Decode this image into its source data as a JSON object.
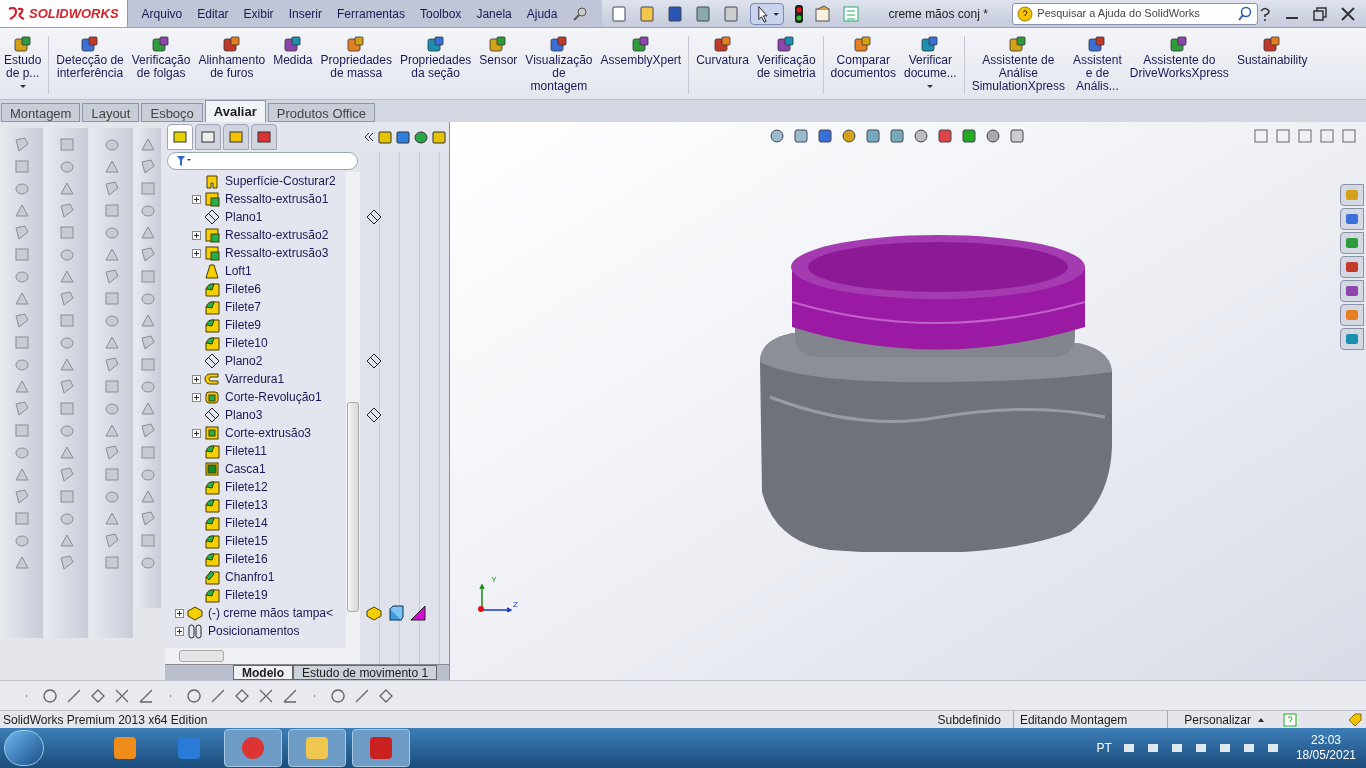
{
  "app": {
    "logo": "SOLIDWORKS",
    "document_title": "creme mãos conj *"
  },
  "menu": [
    "Arquivo",
    "Editar",
    "Exibir",
    "Inserir",
    "Ferramentas",
    "Toolbox",
    "Janela",
    "Ajuda"
  ],
  "search": {
    "placeholder": "Pesquisar a Ajuda do SolidWorks"
  },
  "ribbon": [
    {
      "lines": [
        "Estudo",
        "de p..."
      ],
      "dropdown": true,
      "separator_before": false
    },
    {
      "lines": [
        "Detecção de",
        "interferência"
      ],
      "dropdown": false,
      "separator_before": true
    },
    {
      "lines": [
        "Verificação",
        "de folgas"
      ],
      "dropdown": false,
      "separator_before": false
    },
    {
      "lines": [
        "Alinhamento",
        "de furos"
      ],
      "dropdown": false,
      "separator_before": false
    },
    {
      "lines": [
        "Medida"
      ],
      "dropdown": false,
      "separator_before": false
    },
    {
      "lines": [
        "Propriedades",
        "de massa"
      ],
      "dropdown": false,
      "separator_before": false
    },
    {
      "lines": [
        "Propriedades",
        "da seção"
      ],
      "dropdown": false,
      "separator_before": false
    },
    {
      "lines": [
        "Sensor"
      ],
      "dropdown": false,
      "separator_before": false
    },
    {
      "lines": [
        "Visualização",
        "de",
        "montagem"
      ],
      "dropdown": false,
      "separator_before": false
    },
    {
      "lines": [
        "AssemblyXpert"
      ],
      "dropdown": false,
      "separator_before": false
    },
    {
      "lines": [
        "Curvatura"
      ],
      "dropdown": false,
      "separator_before": true
    },
    {
      "lines": [
        "Verificação",
        "de simetria"
      ],
      "dropdown": false,
      "separator_before": false
    },
    {
      "lines": [
        "Comparar",
        "documentos"
      ],
      "dropdown": false,
      "separator_before": true
    },
    {
      "lines": [
        "Verificar",
        "docume..."
      ],
      "dropdown": true,
      "separator_before": false
    },
    {
      "lines": [
        "Assistente de",
        "Análise",
        "SimulationXpress"
      ],
      "dropdown": false,
      "separator_before": true
    },
    {
      "lines": [
        "Assistent",
        "e de",
        "Anális..."
      ],
      "dropdown": false,
      "separator_before": false
    },
    {
      "lines": [
        "Assistente do",
        "DriveWorksXpress"
      ],
      "dropdown": false,
      "separator_before": false
    },
    {
      "lines": [
        "Sustainability"
      ],
      "dropdown": false,
      "separator_before": false
    }
  ],
  "tabs": [
    {
      "label": "Montagem",
      "selected": false
    },
    {
      "label": "Layout",
      "selected": false
    },
    {
      "label": "Esboço",
      "selected": false
    },
    {
      "label": "Avaliar",
      "selected": true
    },
    {
      "label": "Produtos Office",
      "selected": false
    }
  ],
  "tree": {
    "features": [
      {
        "label": "Superfície-Costurar2",
        "kind": "surface",
        "expandable": false
      },
      {
        "label": "Ressalto-extrusão1",
        "kind": "boss",
        "expandable": true
      },
      {
        "label": "Plano1",
        "kind": "plane",
        "expandable": false
      },
      {
        "label": "Ressalto-extrusão2",
        "kind": "boss",
        "expandable": true
      },
      {
        "label": "Ressalto-extrusão3",
        "kind": "boss",
        "expandable": true
      },
      {
        "label": "Loft1",
        "kind": "loft",
        "expandable": false
      },
      {
        "label": "Filete6",
        "kind": "fillet",
        "expandable": false
      },
      {
        "label": "Filete7",
        "kind": "fillet",
        "expandable": false
      },
      {
        "label": "Filete9",
        "kind": "fillet",
        "expandable": false
      },
      {
        "label": "Filete10",
        "kind": "fillet",
        "expandable": false
      },
      {
        "label": "Plano2",
        "kind": "plane",
        "expandable": false
      },
      {
        "label": "Varredura1",
        "kind": "sweep",
        "expandable": true
      },
      {
        "label": "Corte-Revolução1",
        "kind": "revolve",
        "expandable": true
      },
      {
        "label": "Plano3",
        "kind": "plane",
        "expandable": false
      },
      {
        "label": "Corte-extrusão3",
        "kind": "cut",
        "expandable": true
      },
      {
        "label": "Filete11",
        "kind": "fillet",
        "expandable": false
      },
      {
        "label": "Casca1",
        "kind": "shell",
        "expandable": false
      },
      {
        "label": "Filete12",
        "kind": "fillet",
        "expandable": false
      },
      {
        "label": "Filete13",
        "kind": "fillet",
        "expandable": false
      },
      {
        "label": "Filete14",
        "kind": "fillet",
        "expandable": false
      },
      {
        "label": "Filete15",
        "kind": "fillet",
        "expandable": false
      },
      {
        "label": "Filete16",
        "kind": "fillet",
        "expandable": false
      },
      {
        "label": "Chanfro1",
        "kind": "chamfer",
        "expandable": false
      },
      {
        "label": "Filete19",
        "kind": "fillet",
        "expandable": false
      }
    ],
    "roots": [
      {
        "label": "(-) creme mãos tampa<",
        "kind": "part",
        "expandable": true
      },
      {
        "label": "Posicionamentos",
        "kind": "mates",
        "expandable": true
      }
    ]
  },
  "panel_tabs": [
    {
      "selected": true
    },
    {
      "selected": false
    },
    {
      "selected": false
    },
    {
      "selected": false
    }
  ],
  "bottom_tabs": [
    {
      "label": "Modelo",
      "selected": true
    },
    {
      "label": "Estudo de movimento 1",
      "selected": false
    }
  ],
  "triad": [
    "Y",
    "Z"
  ],
  "status_bar": {
    "edition": "SolidWorks Premium 2013 x64 Edition",
    "state": "Subdefinido",
    "mode": "Editando Montagem",
    "customize": "Personalizar"
  },
  "taskbar": {
    "language": "PT",
    "time": "23:03",
    "date": "18/05/2021"
  }
}
